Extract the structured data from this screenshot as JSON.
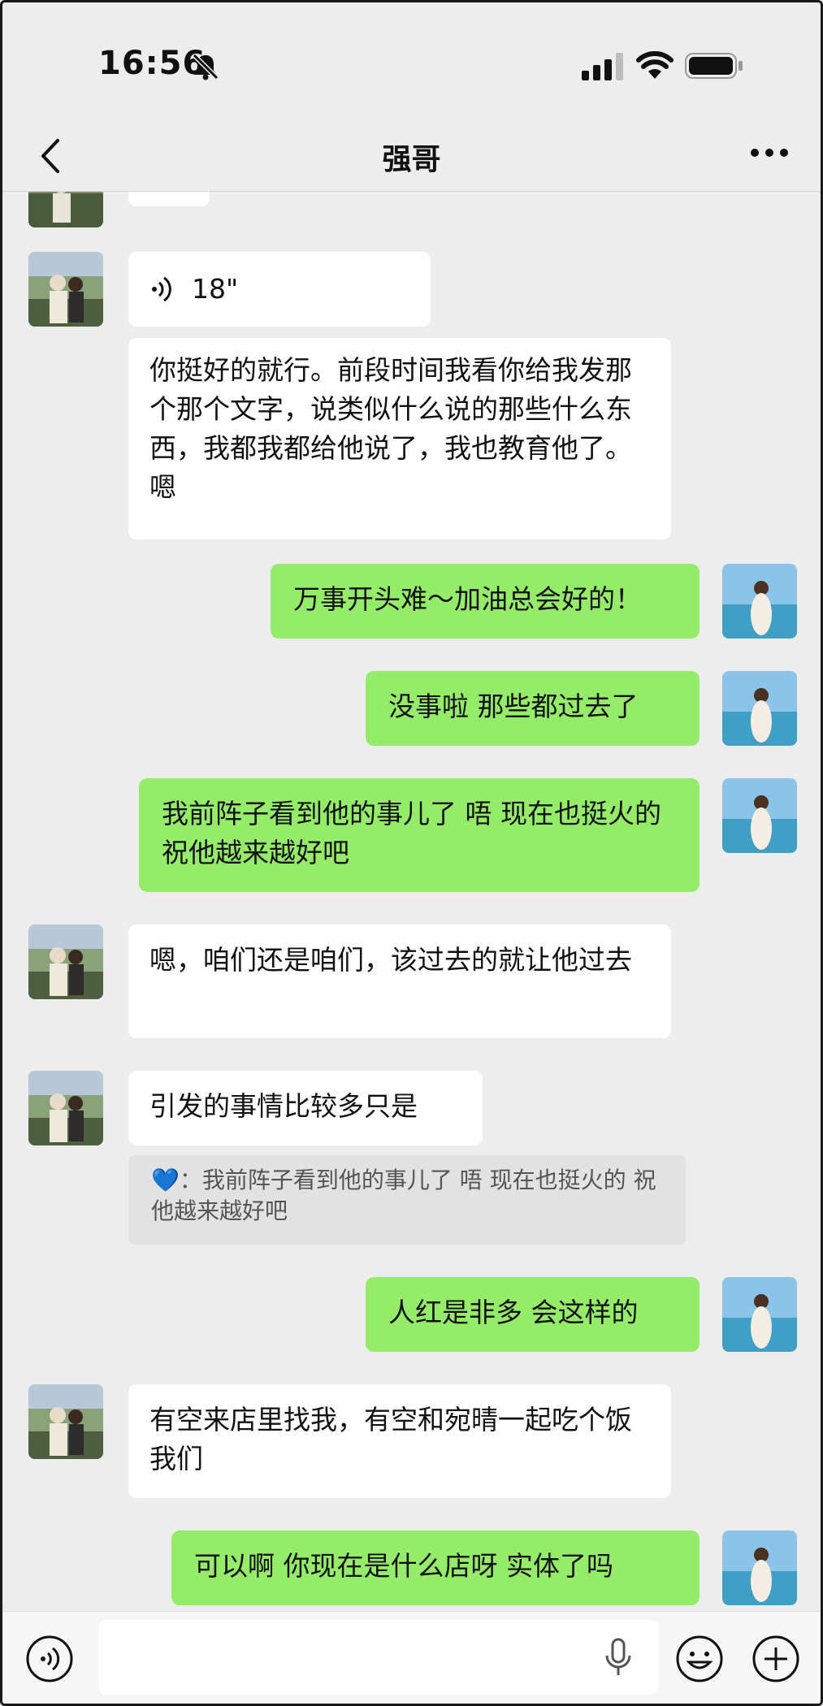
{
  "status": {
    "time": "16:56"
  },
  "nav": {
    "title": "强哥"
  },
  "messages": [
    {
      "from": "contact",
      "type": "voice",
      "duration": "18\""
    },
    {
      "from": "contact",
      "type": "text",
      "text": "你挺好的就行。前段时间我看你给我发那个那个文字，说类似什么说的那些什么东西，我都我都给他说了，我也教育他了。嗯"
    },
    {
      "from": "me",
      "type": "text",
      "text": "万事开头难～加油总会好的！"
    },
    {
      "from": "me",
      "type": "text",
      "text": "没事啦 那些都过去了"
    },
    {
      "from": "me",
      "type": "text",
      "text": "我前阵子看到他的事儿了 唔 现在也挺火的 祝他越来越好吧"
    },
    {
      "from": "contact",
      "type": "text",
      "text": "嗯，咱们还是咱们，该过去的就让他过去"
    },
    {
      "from": "contact",
      "type": "text",
      "text": "引发的事情比较多只是",
      "quote": {
        "sender": "💙：",
        "text": "我前阵子看到他的事儿了 唔 现在也挺火的 祝他越来越好吧"
      }
    },
    {
      "from": "me",
      "type": "text",
      "text": "人红是非多 会这样的"
    },
    {
      "from": "contact",
      "type": "text",
      "text": "有空来店里找我，有空和宛晴一起吃个饭我们"
    },
    {
      "from": "me",
      "type": "text",
      "text": "可以啊 你现在是什么店呀 实体了吗"
    }
  ],
  "colors": {
    "background": "#ededed",
    "bubble_out": "#95ec69",
    "bubble_in": "#ffffff",
    "quote_bg": "#e2e2e2"
  },
  "icons": [
    "bell-off-icon",
    "signal-icon",
    "wifi-icon",
    "battery-icon",
    "back-icon",
    "more-icon",
    "voice-input-icon",
    "mic-icon",
    "emoji-icon",
    "plus-icon"
  ]
}
